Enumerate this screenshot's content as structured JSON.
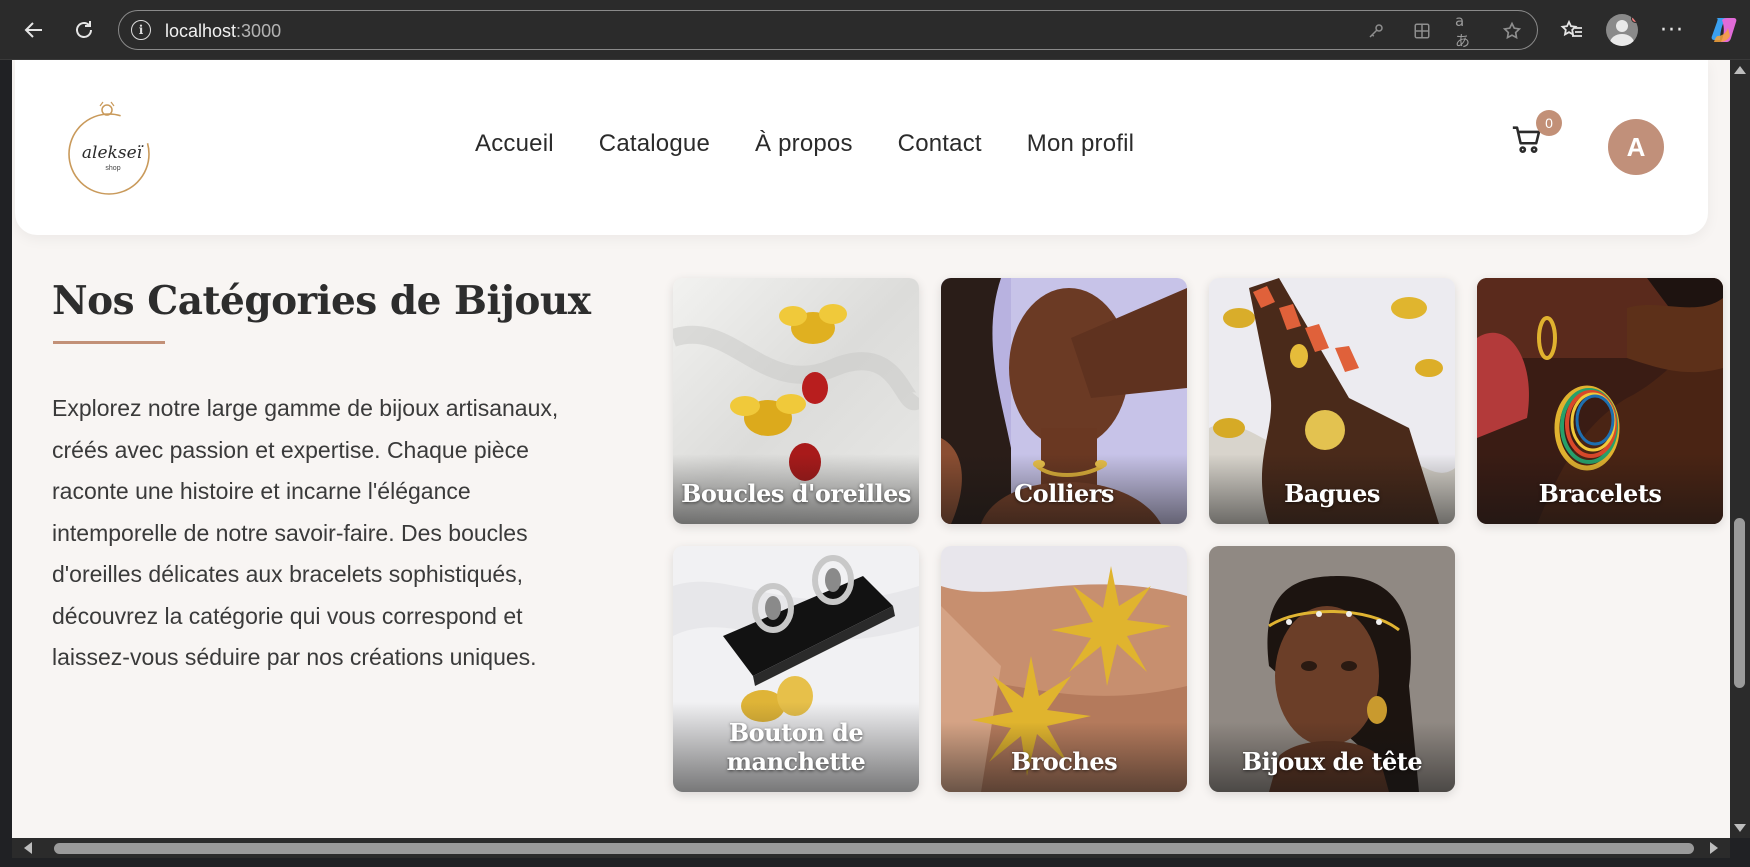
{
  "browser": {
    "url_host": "localhost",
    "url_port": ":3000",
    "icons": [
      "back-icon",
      "reload-icon",
      "site-info-icon",
      "key-icon",
      "apps-icon",
      "read-aloud-icon",
      "favorite-star-icon",
      "favorites-icon",
      "profile-icon",
      "more-icon",
      "copilot-icon"
    ]
  },
  "site": {
    "nav": [
      "Accueil",
      "Catalogue",
      "À propos",
      "Contact",
      "Mon profil"
    ],
    "cart_count": "0",
    "user_initial": "A",
    "logo_text": "alekseï",
    "logo_subtext": "shop",
    "accent_color": "#c29077"
  },
  "section": {
    "title": "Nos Catégories de Bijoux",
    "description": "Explorez notre large gamme de bijoux artisanaux, créés avec passion et expertise. Chaque pièce raconte une histoire et incarne l'élégance intemporelle de notre savoir-faire. Des boucles d'oreilles délicates aux bracelets sophistiqués, découvrez la catégorie qui vous correspond et laissez-vous séduire par nos créations uniques."
  },
  "categories": [
    {
      "label": "Boucles d'oreilles"
    },
    {
      "label": "Colliers"
    },
    {
      "label": "Bagues"
    },
    {
      "label": "Bracelets"
    },
    {
      "label": "Bouton de manchette"
    },
    {
      "label": "Broches"
    },
    {
      "label": "Bijoux de tête"
    }
  ]
}
